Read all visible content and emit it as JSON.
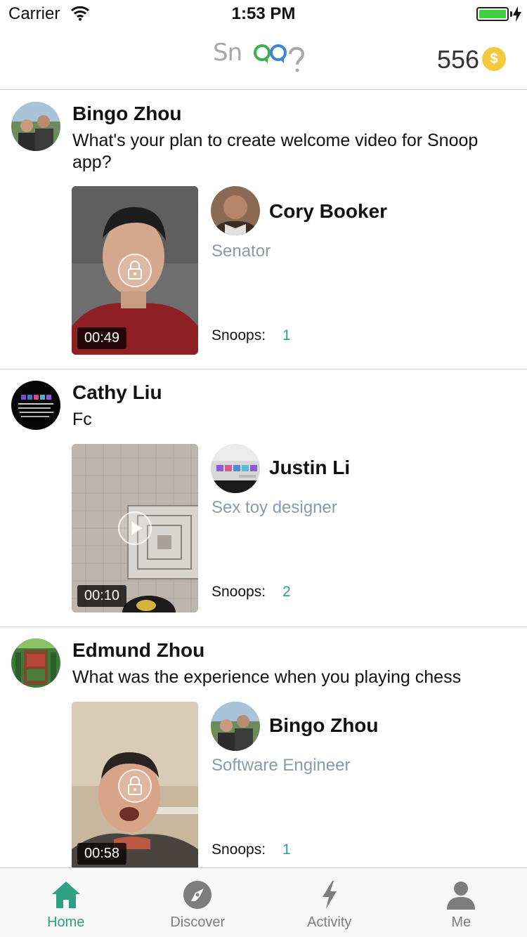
{
  "status_bar": {
    "carrier": "Carrier",
    "time": "1:53 PM"
  },
  "header": {
    "logo_text": "Snoop",
    "coins": "556",
    "coin_symbol": "$",
    "accent_color": "#2fa084"
  },
  "feed": [
    {
      "asker_name": "Bingo Zhou",
      "question": "What's your plan to create welcome video for Snoop app?",
      "video_duration": "00:49",
      "video_state": "locked",
      "answerer_name": "Cory Booker",
      "answerer_title": "Senator",
      "snoops_label": "Snoops:",
      "snoops_count": "1"
    },
    {
      "asker_name": "Cathy Liu",
      "question": "Fc",
      "video_duration": "00:10",
      "video_state": "playable",
      "answerer_name": "Justin Li",
      "answerer_title": "Sex toy designer",
      "snoops_label": "Snoops:",
      "snoops_count": "2"
    },
    {
      "asker_name": "Edmund Zhou",
      "question": "What was the experience when you playing chess",
      "video_duration": "00:58",
      "video_state": "locked",
      "answerer_name": "Bingo Zhou",
      "answerer_title": "Software Engineer",
      "snoops_label": "Snoops:",
      "snoops_count": "1"
    }
  ],
  "tabs": [
    {
      "label": "Home",
      "icon": "home-icon",
      "active": true
    },
    {
      "label": "Discover",
      "icon": "compass-icon",
      "active": false
    },
    {
      "label": "Activity",
      "icon": "lightning-icon",
      "active": false
    },
    {
      "label": "Me",
      "icon": "person-icon",
      "active": false
    }
  ]
}
